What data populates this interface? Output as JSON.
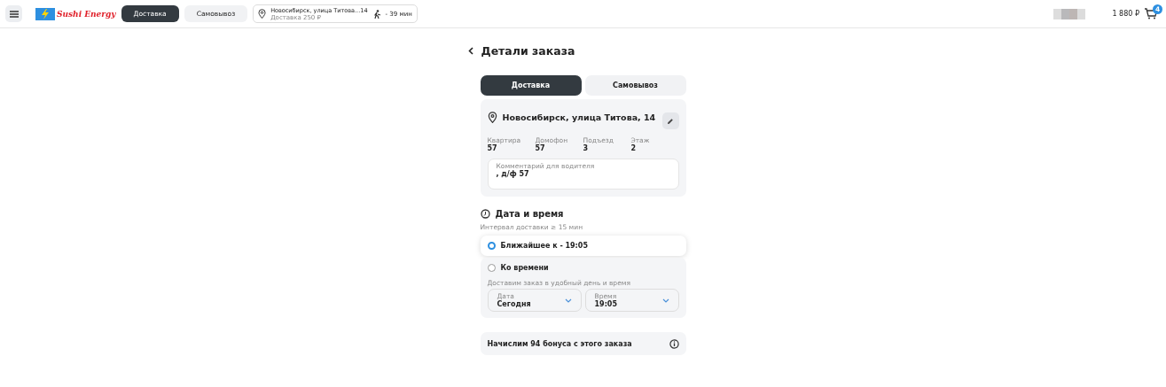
{
  "header": {
    "logo": "Sushi Energy",
    "modes": [
      {
        "label": "Доставка",
        "selected": true
      },
      {
        "label": "Самовывоз",
        "selected": false
      }
    ],
    "address": {
      "line": "Новосибирск, улица Титова...14",
      "cost": "Доставка 250 ₽",
      "eta": "- 39 мин"
    },
    "total": "1 880 ₽",
    "cart_count": "4"
  },
  "page_title": "Детали заказа",
  "tabs": [
    {
      "label": "Доставка",
      "selected": true
    },
    {
      "label": "Самовывоз",
      "selected": false
    }
  ],
  "address_card": {
    "address": "Новосибирск, улица Титова, 14",
    "fields": [
      {
        "label": "Квартира",
        "value": "57"
      },
      {
        "label": "Домофон",
        "value": "57"
      },
      {
        "label": "Подъезд",
        "value": "3"
      },
      {
        "label": "Этаж",
        "value": "2"
      }
    ],
    "comment": {
      "label": "Комментарий для водителя",
      "value": ", д/ф 57"
    }
  },
  "datetime": {
    "title": "Дата и время",
    "hint": "Интервал доставки ≥ 15 мин",
    "options": [
      {
        "label": "Ближайшее к - 19:05",
        "selected": true
      },
      {
        "label": "Ко времени",
        "selected": false,
        "hint": "Доставим заказ в удобный день и время",
        "selects": [
          {
            "label": "Дата",
            "value": "Сегодня"
          },
          {
            "label": "Время",
            "value": "19:05"
          }
        ]
      }
    ]
  },
  "bonus": "Начислим 94 бонуса с этого заказа"
}
